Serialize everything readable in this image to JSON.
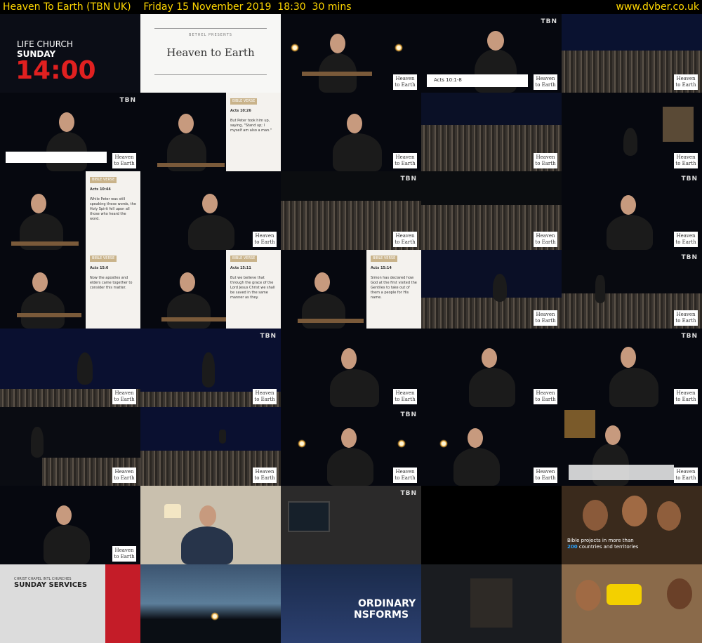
{
  "header": {
    "title": "Heaven To Earth (TBN UK)    Friday 15 November 2019  18:30  30 mins",
    "site": "www.dvber.co.uk"
  },
  "colors": {
    "header_text": "#ffd700",
    "background": "#000000",
    "promo_red": "#e02020"
  },
  "logo_text": {
    "line1": "Heaven",
    "line2": "to Earth"
  },
  "tbn_text": "TBN",
  "promo_life_church": {
    "line1": "LIFE CHURCH",
    "line2": "SUNDAY",
    "time": "14:00"
  },
  "title_card": {
    "kicker": "BETHEL PRESENTS",
    "title": "Heaven to Earth"
  },
  "scripture_ref": "Acts 10:1-8",
  "verse_cards": [
    {
      "tag": "BIBLE VERSE",
      "ref": "Acts 10:26",
      "text": "But Peter took him up, saying, \"Stand up; I myself am also a man.\""
    },
    {
      "tag": "BIBLE VERSE",
      "ref": "Acts 10:44",
      "text": "While Peter was still speaking these words, the Holy Spirit fell upon all those who heard the word."
    },
    {
      "tag": "BIBLE VERSE",
      "ref": "Acts 15:6",
      "text": "Now the apostles and elders came together to consider this matter."
    },
    {
      "tag": "BIBLE VERSE",
      "ref": "Acts 15:11",
      "text": "But we believe that through the grace of the Lord Jesus Christ we shall be saved in the same manner as they."
    },
    {
      "tag": "BIBLE VERSE",
      "ref": "Acts 15:14",
      "text": "Simon has declared how God at the first visited the Gentiles to take out of them a people for His name."
    }
  ],
  "bible_promo": {
    "line1": "Bible projects in more than",
    "highlight": "200",
    "line2": "countries and territories"
  },
  "sunday_services": {
    "kicker": "CHRIST CHAPEL INTL CHURCHES",
    "title": "SUNDAY SERVICES"
  },
  "ordinary": {
    "line1": "ORDINARY",
    "line2": "NSFORMS"
  }
}
